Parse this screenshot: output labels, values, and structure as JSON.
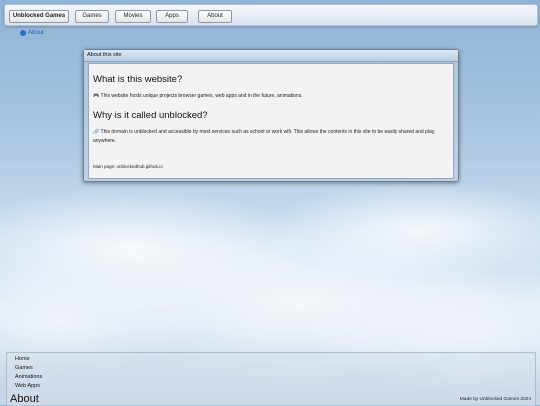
{
  "nav": {
    "brand": "Unblocked Games",
    "items": [
      "Games",
      "Movies",
      "Apps",
      "About"
    ]
  },
  "about_link": {
    "label": "About",
    "icon": "info-icon"
  },
  "window": {
    "title": "About this site",
    "heading1": "What is this website?",
    "para1_icon": "gamepad-icon",
    "para1": "This website hosts unique projects browser games, web apps and in the future, animations.",
    "heading2": "Why is it called unblocked?",
    "para2_icon": "link-icon",
    "para2": "This domain is unblocked and accessible by most services such as school or work wifi. This allows the contents in this site to be easily shared and play, anywhere.",
    "main_page": "Main page: unblockedhub.github.io"
  },
  "footer": {
    "links": [
      "Home",
      "Games",
      "Animations",
      "Web Apps"
    ],
    "heading": "About",
    "credit": "Made by Unblocked Games 2024"
  }
}
